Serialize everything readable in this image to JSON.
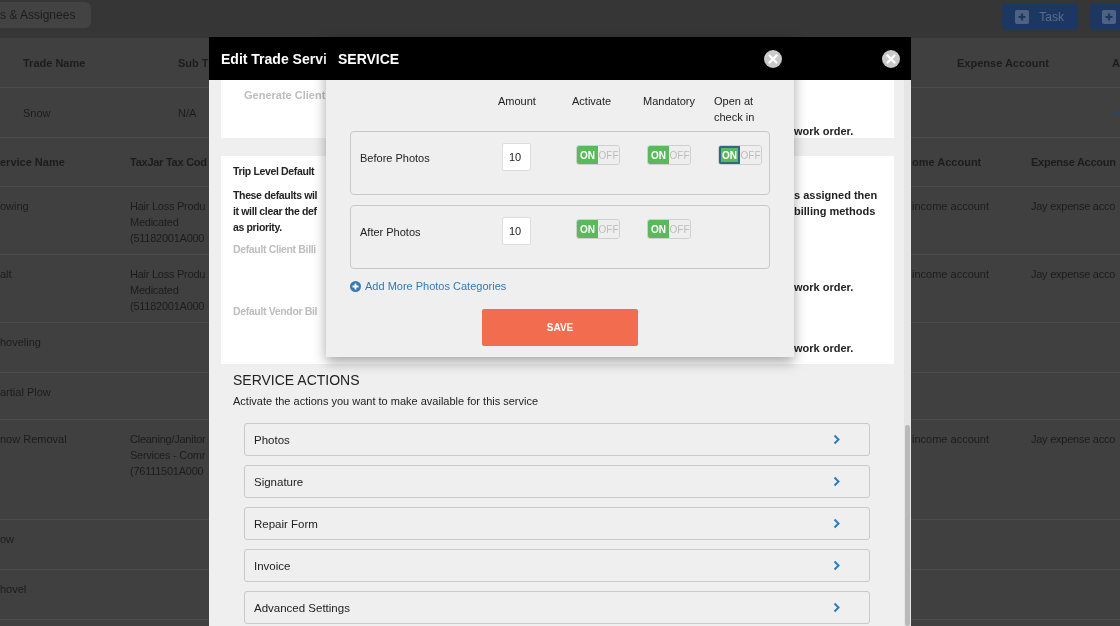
{
  "top_bar": {
    "filter_button": "s & Assignees",
    "task_button": "Task"
  },
  "trade_table": {
    "columns_left": [
      "Trade Name",
      "Sub T"
    ],
    "columns_right": [
      "Expense Account",
      "A"
    ],
    "rows": [
      {
        "trade_name": "Snow",
        "sub_type": "N/A"
      }
    ]
  },
  "services_table": {
    "columns_left": [
      "ervice Name",
      "TaxJar Tax Cod"
    ],
    "columns_right": [
      "ome Account",
      "Expense Accoun"
    ],
    "rows": [
      {
        "name": "owing",
        "tax_code": "Hair Loss Produ\nMedicated\n(51182001A000",
        "income_account": "income account",
        "expense_account": "Jay expense acco"
      },
      {
        "name": "alt",
        "tax_code": "Hair Loss Produ\nMedicated\n(51182001A000",
        "income_account": "income account",
        "expense_account": "Jay expense acco"
      },
      {
        "name": "hoveling"
      },
      {
        "name": "artial Plow"
      },
      {
        "name": "now Removal",
        "tax_code": "Cleaning/Janitor\nServices - Comr\n(76111501A000",
        "income_account": "income account",
        "expense_account": "Jay expense acco"
      },
      {
        "name": "ow"
      },
      {
        "name": "hovel"
      }
    ]
  },
  "edit_modal": {
    "title": "Edit Trade Servi",
    "client_card": {
      "label": "Generate Client",
      "note": "work order."
    },
    "defaults_card": {
      "title": "Trip Level Default",
      "text_left": "These defaults wil\nit will clear the def\nas priority.",
      "text_right": "s assigned then\nbilling methods",
      "client_billing_label": "Default Client Billi",
      "client_billing_note": "work order.",
      "vendor_billing_label": "Default Vendor Bil",
      "vendor_billing_note": "work order."
    },
    "actions_title": "SERVICE ACTIONS",
    "actions_subtitle": "Activate the actions you want to make available for this service",
    "actions": [
      "Photos",
      "Signature",
      "Repair Form",
      "Invoice",
      "Advanced Settings"
    ]
  },
  "service_popup": {
    "title": "SERVICE",
    "columns": [
      "Amount",
      "Activate",
      "Mandatory",
      "Open at\ncheck in"
    ],
    "rows": [
      {
        "label": "Before Photos",
        "amount": "10",
        "switches": [
          {
            "on": true,
            "focused": false,
            "on_text": "ON",
            "off_text": "OFF"
          },
          {
            "on": true,
            "focused": false,
            "on_text": "ON",
            "off_text": "OFF"
          },
          {
            "on": true,
            "focused": true,
            "on_text": "ON",
            "off_text": "OFF"
          }
        ]
      },
      {
        "label": "After Photos",
        "amount": "10",
        "switches": [
          {
            "on": true,
            "focused": false,
            "on_text": "ON",
            "off_text": "OFF"
          },
          {
            "on": true,
            "focused": false,
            "on_text": "ON",
            "off_text": "OFF"
          }
        ]
      }
    ],
    "add_link": "Add More Photos Categories",
    "save_button": "SAVE"
  }
}
